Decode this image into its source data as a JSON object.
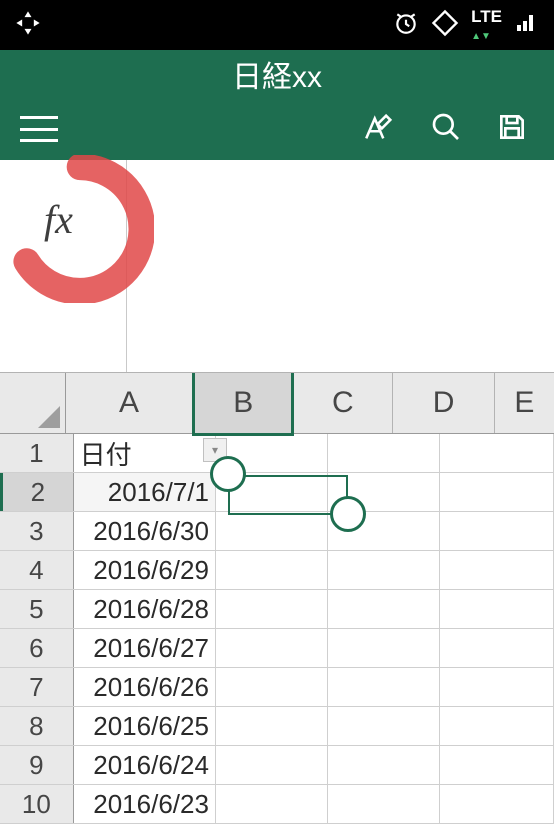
{
  "status": {
    "lte": "LTE"
  },
  "title": "日経xx",
  "fx_label": "fx",
  "columns": [
    "A",
    "B",
    "C",
    "D",
    "E"
  ],
  "row_numbers": [
    "1",
    "2",
    "3",
    "4",
    "5",
    "6",
    "7",
    "8",
    "9",
    "10"
  ],
  "header_cell": "日付",
  "dates": [
    "2016/7/1",
    "2016/6/30",
    "2016/6/29",
    "2016/6/28",
    "2016/6/27",
    "2016/6/26",
    "2016/6/25",
    "2016/6/24",
    "2016/6/23"
  ],
  "selected_cell": "B2",
  "active_column": "B"
}
